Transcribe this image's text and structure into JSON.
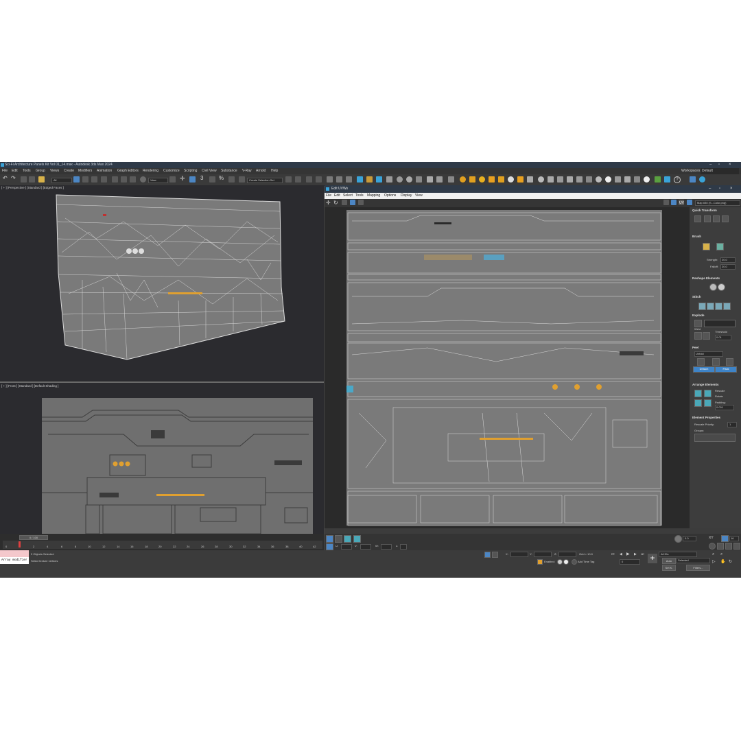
{
  "window": {
    "title": "Sci-Fi Architecture Panels Kit Vol 01_14.max - Autodesk 3ds Max 2024",
    "workspace_label": "Workspaces:",
    "workspace_value": "Default"
  },
  "menubar": [
    "File",
    "Edit",
    "Tools",
    "Group",
    "Views",
    "Create",
    "Modifiers",
    "Animation",
    "Graph Editors",
    "Rendering",
    "Customize",
    "Scripting",
    "Civil View",
    "Substance",
    "V-Ray",
    "Arnold",
    "Help"
  ],
  "toolbar": {
    "filter_value": "All",
    "view_value": "View",
    "selection_set": "Create Selection Set"
  },
  "viewport_top": {
    "label": "[ + ] [Perspective ] [Standard ] [Edged Faces ]"
  },
  "viewport_bottom": {
    "label": "[ + ] [Front ] [Standard ] [Default Shading ]"
  },
  "uv_editor": {
    "title": "Edit UVWs",
    "menu": [
      "File",
      "Edit",
      "Select",
      "Tools",
      "Mapping",
      "Options",
      "Display",
      "View"
    ],
    "map_select": "Map #30 (S...Color.png)",
    "uv_label": "UV"
  },
  "side_panel": {
    "quick_transform": "Quick Transform",
    "brush": "Brush",
    "strength_label": "Strength:",
    "strength_value": "20.0",
    "falloff_label": "Falloff:",
    "falloff_value": "20.0",
    "reshape": "Reshape Elements",
    "stitch": "Stitch",
    "explode": "Explode",
    "weld": "Weld",
    "threshold_label": "Threshold",
    "threshold_value": "0.01",
    "peel": "Peel",
    "peel_mode": "Unfold",
    "detach": "Detach",
    "pack": "Pack",
    "arrange": "Arrange Elements",
    "rescale": "Rescale",
    "rotate": "Rotate",
    "padding_label": "Padding:",
    "padding_value": "0.001",
    "element_props": "Element Properties",
    "rescale_priority": "Rescale Priority:",
    "rescale_priority_value": "1",
    "groups": "Groups:"
  },
  "timeline": {
    "frame_counter": "0 / 100",
    "ticks": [
      "0",
      "2",
      "4",
      "6",
      "8",
      "10",
      "12",
      "14",
      "16",
      "18",
      "20",
      "22",
      "24",
      "26",
      "28",
      "30",
      "32",
      "34",
      "36",
      "38",
      "40",
      "42"
    ]
  },
  "uv_bottom": {
    "u_label": "U:",
    "v_label": "V:",
    "w_label": "W:",
    "l_label": "L:",
    "value": "0.0",
    "xy_label": "XY",
    "count": "16"
  },
  "status": {
    "modifier": "Array modifier",
    "objects_selected": "3 Objects Selected",
    "prompt": "Select texture vertices",
    "x_label": "X:",
    "y_label": "Y:",
    "z_label": "Z:",
    "grid": "Grid = 10.0",
    "enabled": "Enabled:",
    "add_time_tag": "Add Time Tag",
    "selection_filter": "All IDs",
    "auto": "Auto",
    "selected": "Selected",
    "set_k": "Set K.",
    "filters": "Filters...",
    "frame": "0"
  }
}
